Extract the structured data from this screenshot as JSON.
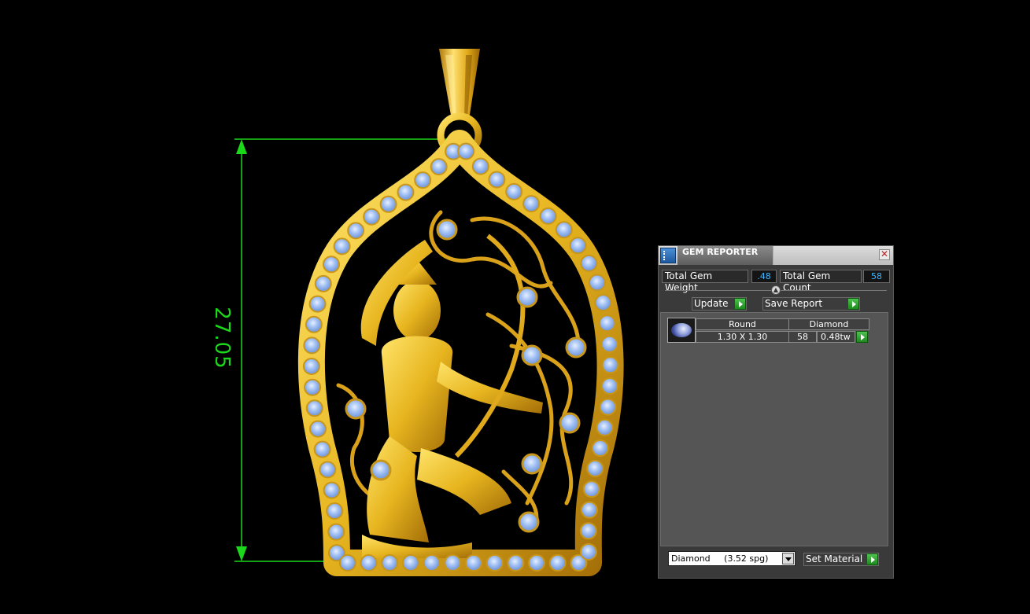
{
  "viewport": {
    "dimension_value": "27.05",
    "dimension_color": "#1bd81b",
    "metal_color": "#e7b51f",
    "stone_color": "#8fb4ee",
    "background": "#000000"
  },
  "gem_reporter": {
    "title": "GEM REPORTER",
    "close_symbol": "✕",
    "total_gem_weight_label": "Total Gem Weight",
    "total_gem_weight_value": ".48",
    "total_gem_count_label": "Total Gem Count",
    "total_gem_count_value": "58",
    "update_label": "Update",
    "save_report_label": "Save Report",
    "gem_rows": [
      {
        "shape": "Round",
        "material": "Diamond",
        "size": "1.30 X 1.30",
        "count": "58",
        "weight": "0.48tw"
      }
    ],
    "material_select_value": "Diamond     (3.52 spg)",
    "set_material_label": "Set Material",
    "accent_value_color": "#3fb6ff",
    "go_button_color": "#2ea52e"
  }
}
